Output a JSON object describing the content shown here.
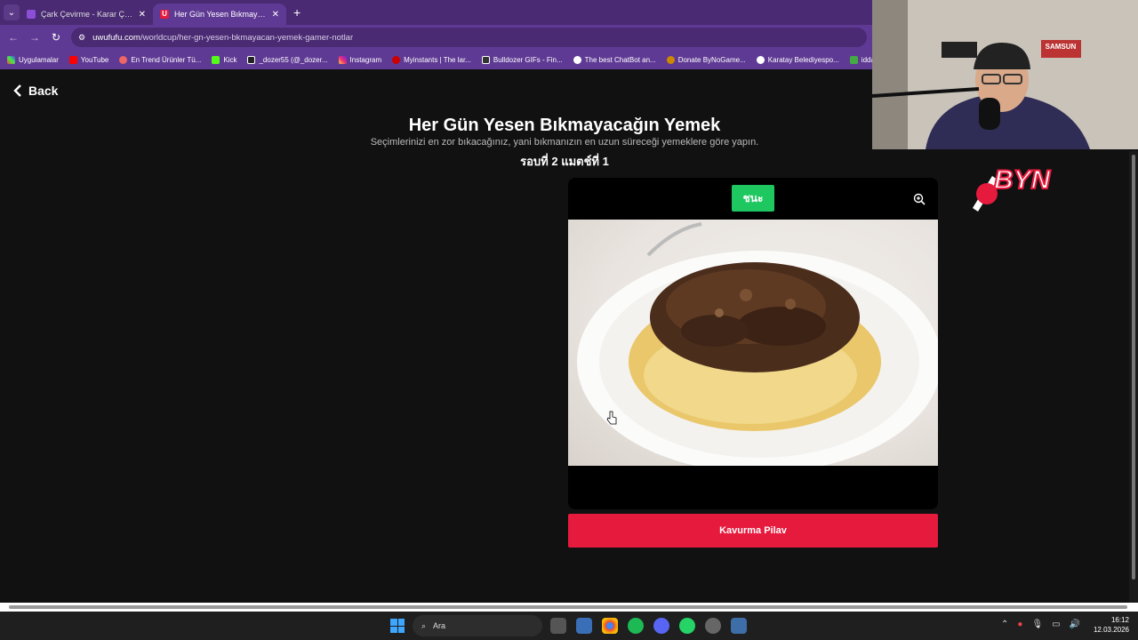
{
  "browser": {
    "tabs": [
      {
        "title": "Çark Çevirme - Karar Çarkı!",
        "active": false
      },
      {
        "title": "Her Gün Yesen Bıkmayacağın Y",
        "active": true
      }
    ],
    "url_host": "uwufufu.com",
    "url_path": "/worldcup/her-gn-yesen-bkmayacan-yemek-gamer-notlar",
    "bookmarks": [
      "Uygulamalar",
      "YouTube",
      "En Trend Ürünler Tü...",
      "Kick",
      "_dozer55 (@_dozer...",
      "Instagram",
      "Myinstants | The lar...",
      "Bulldozer GIFs - Fin...",
      "The best ChatBot an...",
      "Donate ByNoGame...",
      "Karatay Belediyespo...",
      "idda"
    ]
  },
  "page": {
    "back_label": "Back",
    "title": "Her Gün Yesen Bıkmayacağın Yemek",
    "description": "Seçimlerinizi en zor bıkacağınız, yani bıkmanızın en uzun süreceği yemeklere göre yapın.",
    "round_label": "รอบที่ 2 แมตช์ที่ 1",
    "winner_badge": "ชนะ",
    "item_name": "Kavurma Pilav"
  },
  "webcam": {
    "sign_label": "SAMSUN",
    "overlay_logo": "BYN"
  },
  "taskbar": {
    "search_placeholder": "Ara",
    "time": "16:12",
    "date": "12.03.2026"
  },
  "colors": {
    "browser_frame": "#5f3a94",
    "tab_strip": "#4a2a73",
    "winner_green": "#1ec760",
    "choice_red": "#e61a3d",
    "page_bg": "#111111"
  }
}
